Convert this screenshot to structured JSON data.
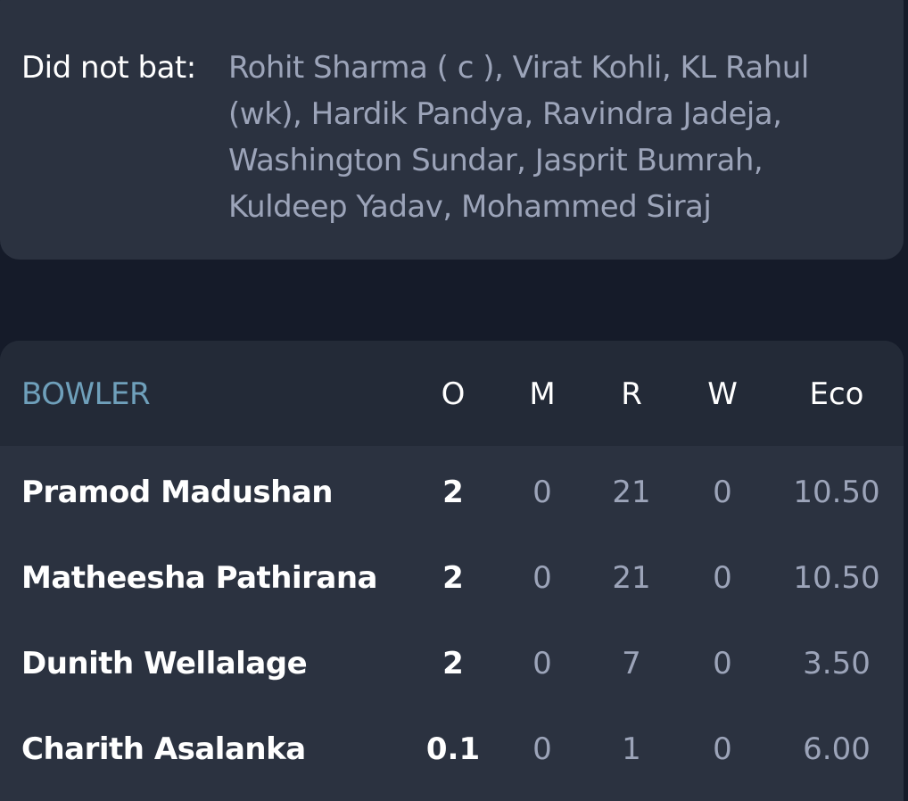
{
  "did_not_bat": {
    "label": "Did not bat:",
    "players": "Rohit Sharma ( c ), Virat Kohli, KL Rahul (wk), Hardik Pandya, Ravindra Jadeja, Washington Sundar, Jasprit Bumrah, Kuldeep Yadav, Mohammed Siraj"
  },
  "bowling": {
    "headers": {
      "bowler": "BOWLER",
      "overs": "O",
      "maidens": "M",
      "runs": "R",
      "wickets": "W",
      "economy": "Eco"
    },
    "rows": [
      {
        "name": "Pramod Madushan",
        "overs": "2",
        "maidens": "0",
        "runs": "21",
        "wickets": "0",
        "economy": "10.50"
      },
      {
        "name": "Matheesha Pathirana",
        "overs": "2",
        "maidens": "0",
        "runs": "21",
        "wickets": "0",
        "economy": "10.50"
      },
      {
        "name": "Dunith Wellalage",
        "overs": "2",
        "maidens": "0",
        "runs": "7",
        "wickets": "0",
        "economy": "3.50"
      },
      {
        "name": "Charith Asalanka",
        "overs": "0.1",
        "maidens": "0",
        "runs": "1",
        "wickets": "0",
        "economy": "6.00"
      }
    ]
  },
  "colors": {
    "background": "#151b29",
    "card": "#2b3240",
    "header_bg": "#232a37",
    "accent": "#6fa0bb",
    "muted_text": "#9ca4b9"
  }
}
